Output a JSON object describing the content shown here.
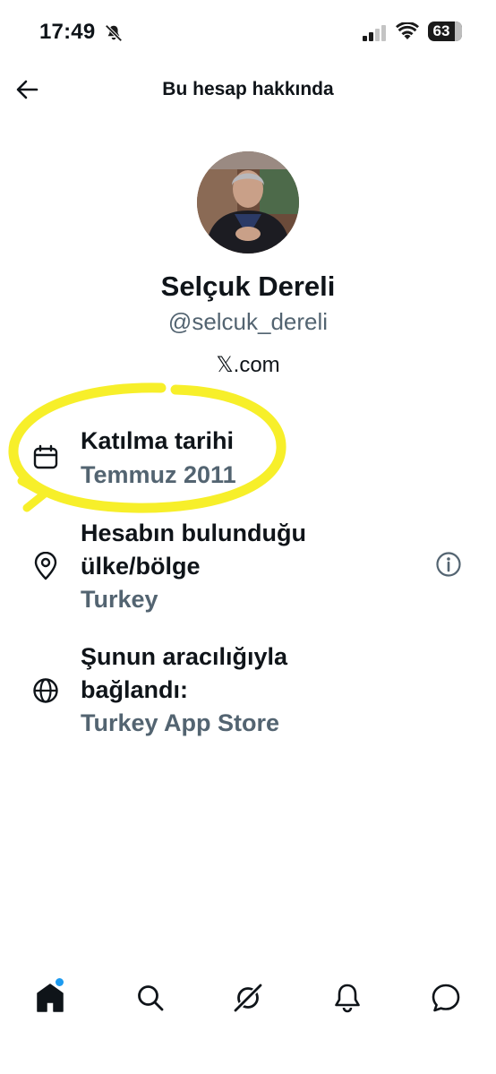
{
  "status_bar": {
    "time": "17:49",
    "battery": "63"
  },
  "header": {
    "title": "Bu hesap hakkında"
  },
  "profile": {
    "name": "Selçuk Dereli",
    "handle": "@selcuk_dereli",
    "platform": "𝕏.com"
  },
  "details": {
    "joined": {
      "label": "Katılma tarihi",
      "value": "Temmuz 2011",
      "icon": "calendar-icon"
    },
    "location": {
      "label_line1": "Hesabın bulunduğu",
      "label_line2": "ülke/bölge",
      "value": "Turkey",
      "icon": "location-pin-icon"
    },
    "connected": {
      "label_line1": "Şunun aracılığıyla",
      "label_line2": "bağlandı:",
      "value": "Turkey App Store",
      "icon": "globe-icon"
    }
  },
  "tabs": [
    "home-icon",
    "search-icon",
    "grok-icon",
    "notifications-icon",
    "messages-icon"
  ],
  "colors": {
    "text": "#0f1419",
    "secondary": "#536471",
    "highlight": "#f7ef2a",
    "accent": "#1d9bf0"
  }
}
